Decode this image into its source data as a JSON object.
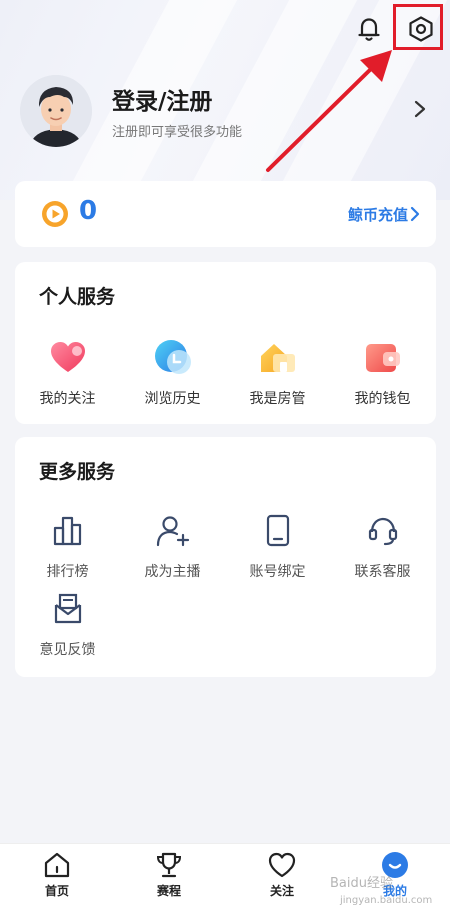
{
  "header": {
    "login_title": "登录/注册",
    "login_subtitle": "注册即可享受很多功能"
  },
  "coins": {
    "value": "0",
    "recharge_label": "鲸币充值"
  },
  "personal_services": {
    "title": "个人服务",
    "items": [
      {
        "label": "我的关注",
        "icon": "heart-icon"
      },
      {
        "label": "浏览历史",
        "icon": "clock-icon"
      },
      {
        "label": "我是房管",
        "icon": "house-icon"
      },
      {
        "label": "我的钱包",
        "icon": "wallet-icon"
      }
    ]
  },
  "more_services": {
    "title": "更多服务",
    "items": [
      {
        "label": "排行榜",
        "icon": "ranking-icon"
      },
      {
        "label": "成为主播",
        "icon": "add-user-icon"
      },
      {
        "label": "账号绑定",
        "icon": "tablet-icon"
      },
      {
        "label": "联系客服",
        "icon": "headset-icon"
      },
      {
        "label": "意见反馈",
        "icon": "feedback-icon"
      }
    ]
  },
  "bottom_nav": [
    {
      "label": "首页",
      "icon": "home-icon"
    },
    {
      "label": "赛程",
      "icon": "trophy-icon"
    },
    {
      "label": "关注",
      "icon": "heart-outline-icon"
    },
    {
      "label": "我的",
      "icon": "profile-icon"
    }
  ],
  "watermark": {
    "text": "Baidu经验",
    "sub": "jingyan.baidu.com"
  },
  "colors": {
    "accent": "#2c7be5",
    "highlight": "#e11d2a"
  }
}
